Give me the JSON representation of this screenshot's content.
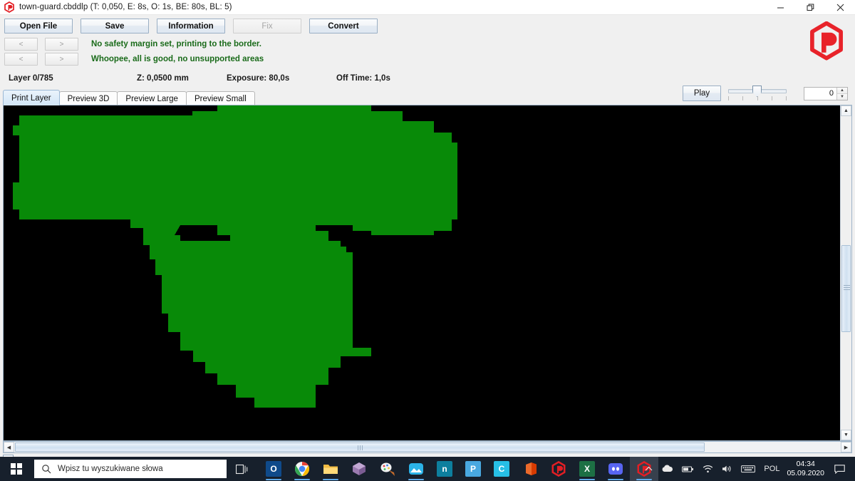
{
  "window": {
    "title": "town-guard.cbddlp (T: 0,050, E: 8s, O: 1s, BE: 80s, BL: 5)",
    "app_icon": "uvtools-icon",
    "minimize": "─",
    "maximize": "❐",
    "close": "✕"
  },
  "toolbar": {
    "buttons": [
      {
        "label": "Open File",
        "name": "open-file-button",
        "disabled": false
      },
      {
        "label": "Save",
        "name": "save-button",
        "disabled": false
      },
      {
        "label": "Information",
        "name": "information-button",
        "disabled": false
      },
      {
        "label": "Fix",
        "name": "fix-button",
        "disabled": true
      },
      {
        "label": "Convert",
        "name": "convert-button",
        "disabled": false
      }
    ]
  },
  "issues": [
    {
      "prev_label": "<",
      "next_label": ">",
      "message": "No safety margin set, printing to the border.",
      "color": "#1a6b1a"
    },
    {
      "prev_label": "<",
      "next_label": ">",
      "message": "Whoopee, all is good, no unsupported areas",
      "color": "#1a6b1a"
    }
  ],
  "status": {
    "layer": "Layer 0/785",
    "z": "Z: 0,0500 mm",
    "exposure": "Exposure: 80,0s",
    "off_time": "Off Time: 1,0s"
  },
  "playback": {
    "play_label": "Play",
    "slider_value": 50,
    "slider_ticks": 5,
    "spinner_value": "0",
    "spinner_up": "▲",
    "spinner_down": "▼"
  },
  "tabs": [
    {
      "label": "Print Layer",
      "name": "tab-print-layer",
      "active": true
    },
    {
      "label": "Preview 3D",
      "name": "tab-preview-3d",
      "active": false
    },
    {
      "label": "Preview Large",
      "name": "tab-preview-large",
      "active": false
    },
    {
      "label": "Preview Small",
      "name": "tab-preview-small",
      "active": false
    }
  ],
  "viewer": {
    "background_color": "#000000",
    "layer_color": "#088A08",
    "layer_index": 0,
    "layer_total": 785
  },
  "scrollbars": {
    "vertical": {
      "up": "▲",
      "down": "▼",
      "thumb_position_pct": 42
    },
    "horizontal": {
      "left": "◀",
      "right": "▶",
      "thumb_position_pct": 0
    }
  },
  "layer_slider": {
    "value": 0,
    "min": 0,
    "max": 785
  },
  "taskbar": {
    "start_icon": "windows-logo-icon",
    "search_placeholder": "Wpisz tu wyszukiwane słowa",
    "search_icon": "search-icon",
    "task_view_icon": "task-view-icon",
    "apps": [
      {
        "name": "taskbar-outlook",
        "glyph": "O",
        "bg": "#0f4a8a",
        "running": true
      },
      {
        "name": "taskbar-chrome",
        "glyph": "",
        "bg": "#ffffff",
        "running": true
      },
      {
        "name": "taskbar-file-explorer",
        "glyph": "",
        "bg": "#f5b942",
        "running": true
      },
      {
        "name": "taskbar-3d-builder",
        "glyph": "",
        "bg": "#8e6f9e",
        "running": false
      },
      {
        "name": "taskbar-paint-3d",
        "glyph": "",
        "bg": "#e8e8e8",
        "running": false
      },
      {
        "name": "taskbar-photos",
        "glyph": "",
        "bg": "#2bb3e8",
        "running": true
      },
      {
        "name": "taskbar-nanodlp",
        "glyph": "n",
        "bg": "#0d7f9e",
        "running": false
      },
      {
        "name": "taskbar-photoshop",
        "glyph": "P",
        "bg": "#49a8e0",
        "running": false
      },
      {
        "name": "taskbar-chitubox",
        "glyph": "C",
        "bg": "#27bfe6",
        "running": false
      },
      {
        "name": "taskbar-office",
        "glyph": "",
        "bg": "#d83b01",
        "running": false
      },
      {
        "name": "taskbar-uvtools-alt",
        "glyph": "",
        "bg": "#d91f2b",
        "running": false
      },
      {
        "name": "taskbar-excel",
        "glyph": "X",
        "bg": "#1d7044",
        "running": true
      },
      {
        "name": "taskbar-discord",
        "glyph": "",
        "bg": "#5865f2",
        "running": true
      },
      {
        "name": "taskbar-uvtools",
        "glyph": "",
        "bg": "#d91f2b",
        "running": true,
        "active": true
      }
    ],
    "tray": {
      "chevron": "⌃",
      "onedrive_icon": "cloud-icon",
      "battery_icon": "battery-icon",
      "wifi_icon": "wifi-icon",
      "volume_icon": "volume-icon",
      "keyboard_icon": "keyboard-icon",
      "language": "POL",
      "time": "04:34",
      "date": "05.09.2020",
      "action_center_icon": "notification-icon"
    }
  }
}
